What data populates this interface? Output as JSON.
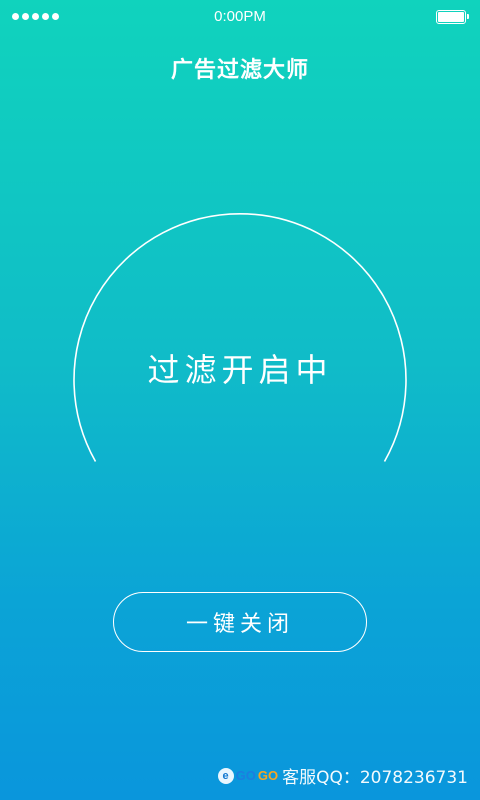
{
  "status_bar": {
    "time": "0:00PM",
    "signal_dots": 5,
    "battery_level": 1.0
  },
  "header": {
    "title": "广告过滤大师"
  },
  "filter_ring": {
    "status_text": "过滤开启中"
  },
  "actions": {
    "close_label": "一键关闭"
  },
  "watermark": {
    "logo_icon": "e-logo-icon",
    "logo_text_1": "GO",
    "logo_text_2": "GO",
    "text": "客服QQ：2078236731"
  },
  "colors": {
    "gradient_top": "#10d3bd",
    "gradient_bottom": "#0a96dc",
    "foreground": "#ffffff"
  }
}
